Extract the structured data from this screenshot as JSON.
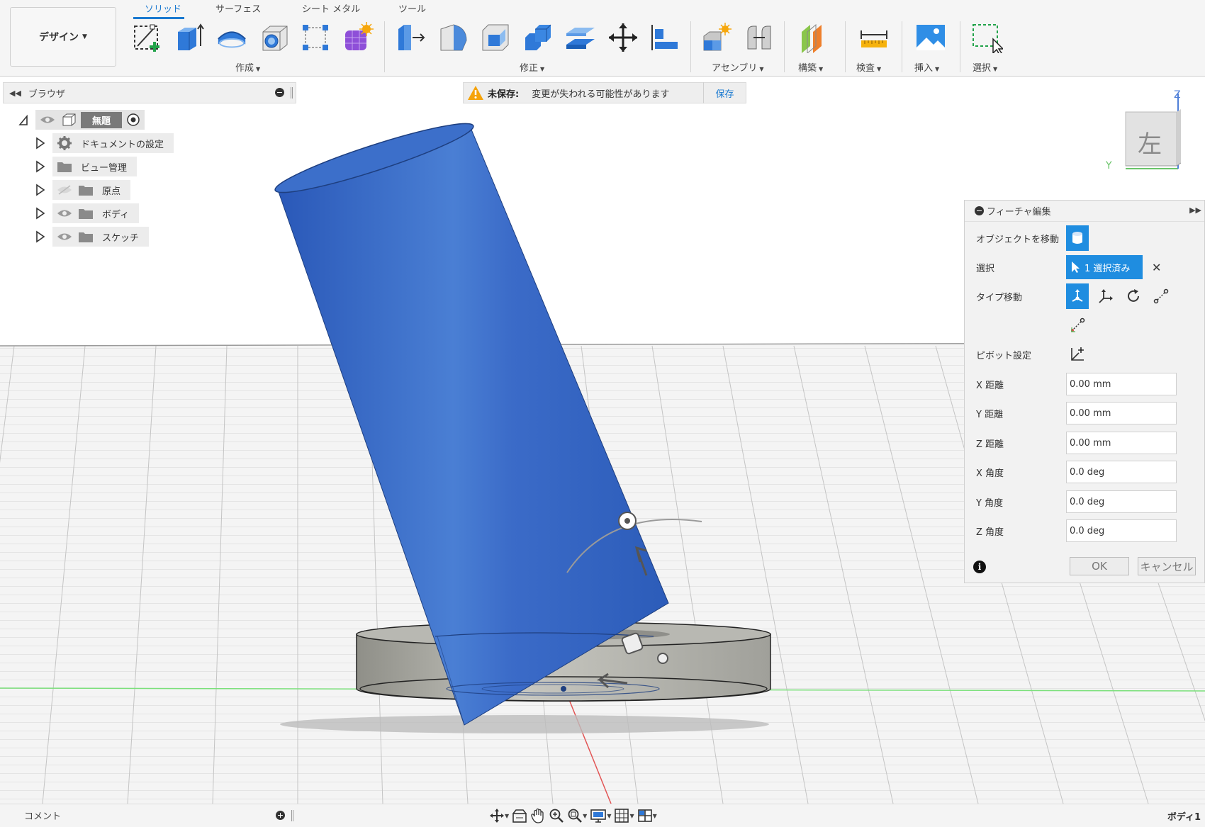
{
  "toolbar": {
    "workspace": "デザイン",
    "tabs": [
      "ソリッド",
      "サーフェス",
      "シート メタル",
      "ツール"
    ],
    "groups": {
      "create": "作成",
      "modify": "修正",
      "assemble": "アセンブリ",
      "construct": "構築",
      "inspect": "検査",
      "insert": "挿入",
      "select": "選択"
    }
  },
  "browser": {
    "title": "ブラウザ",
    "root": "無題",
    "items": [
      {
        "label": "ドキュメントの設定",
        "icon": "gear-icon"
      },
      {
        "label": "ビュー管理",
        "icon": "folder-icon"
      },
      {
        "label": "原点",
        "icon": "folder-icon"
      },
      {
        "label": "ボディ",
        "icon": "folder-icon"
      },
      {
        "label": "スケッチ",
        "icon": "folder-icon"
      }
    ]
  },
  "banner": {
    "status": "未保存:",
    "message": "変更が失われる可能性があります",
    "save": "保存"
  },
  "viewcube": {
    "face": "左",
    "axis_z": "Z",
    "axis_y": "Y"
  },
  "feature_panel": {
    "title": "フィーチャ編集",
    "object_move_label": "オブジェクトを移動",
    "select_label": "選択",
    "selected_text": "1 選択済み",
    "move_type_label": "タイプ移動",
    "pivot_label": "ピボット設定",
    "fields": [
      {
        "label": "X 距離",
        "value": "0.00 mm"
      },
      {
        "label": "Y 距離",
        "value": "0.00 mm"
      },
      {
        "label": "Z 距離",
        "value": "0.00 mm"
      },
      {
        "label": "X 角度",
        "value": "0.0 deg"
      },
      {
        "label": "Y 角度",
        "value": "0.0 deg"
      },
      {
        "label": "Z 角度",
        "value": "0.0 deg"
      }
    ],
    "ok": "OK",
    "cancel": "キャンセル"
  },
  "bottom": {
    "comments": "コメント",
    "body_name": "ボディ1"
  },
  "colors": {
    "accent": "#1f8de0",
    "body_blue": "#3d6cc4",
    "washer_gray": "#a9a9a3"
  }
}
